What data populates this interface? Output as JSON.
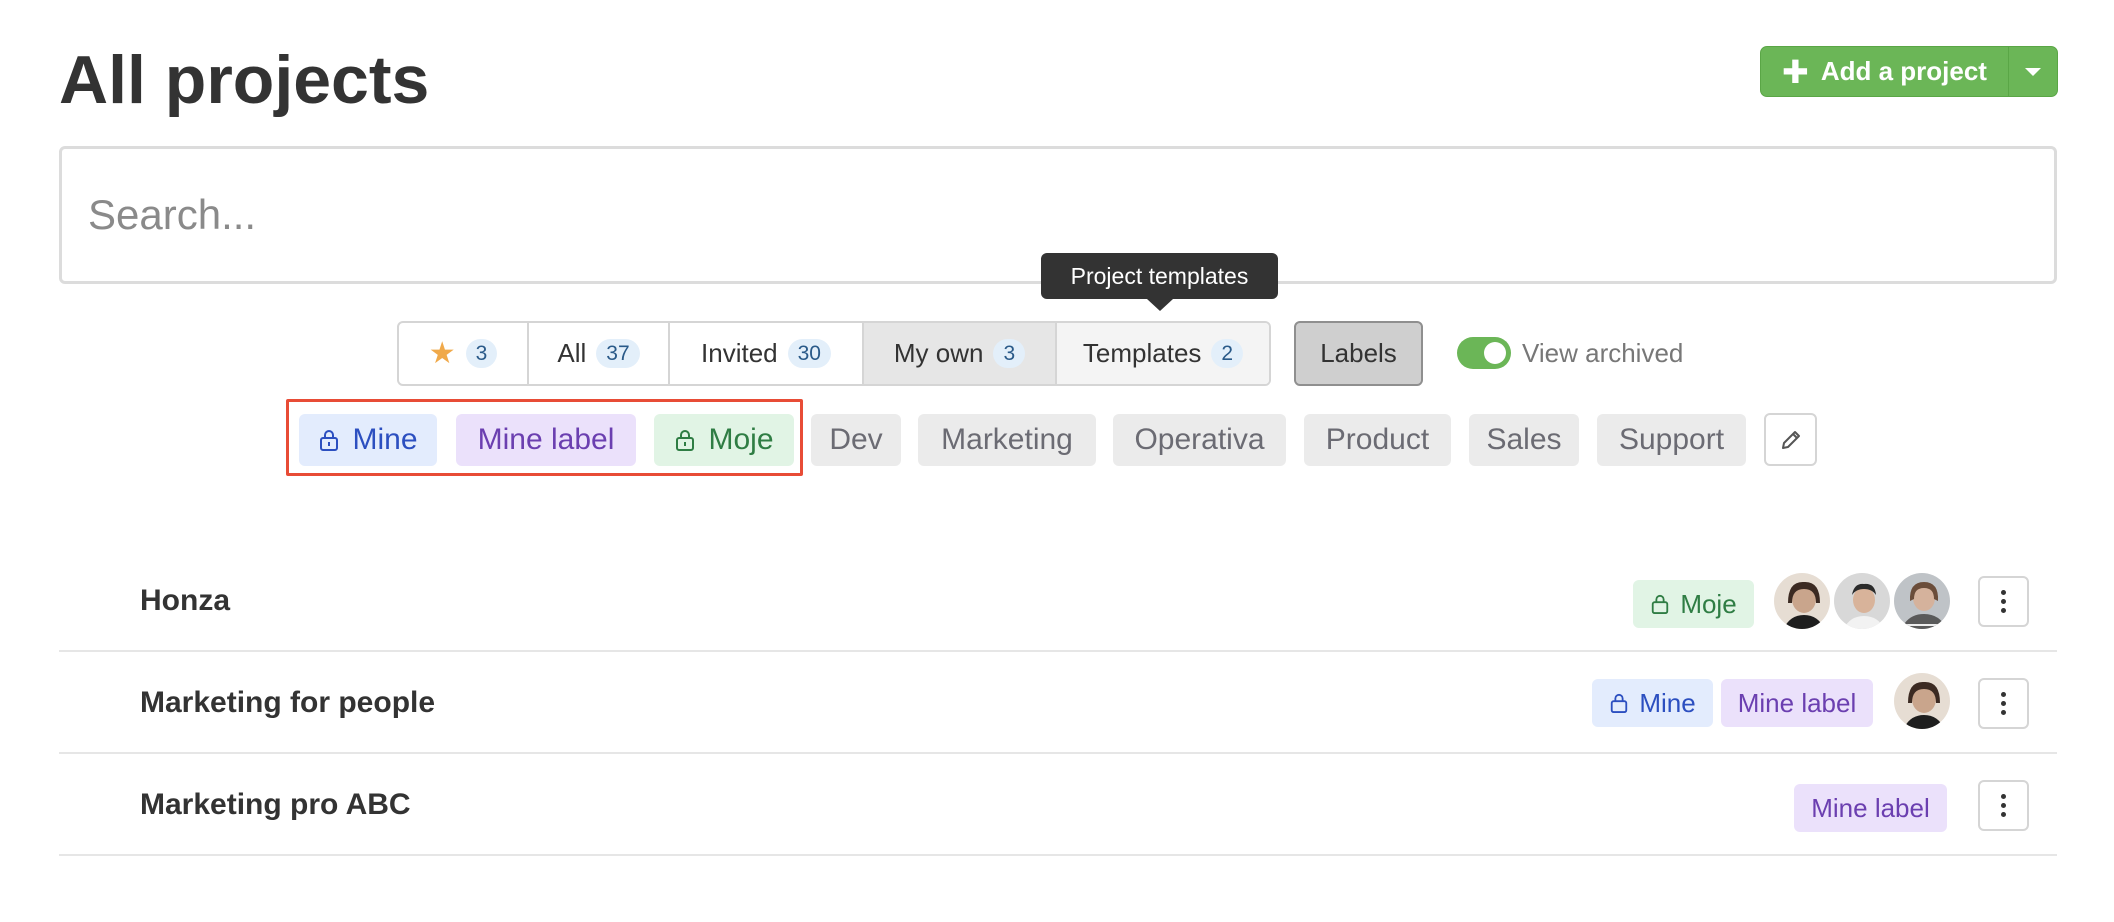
{
  "header": {
    "title": "All projects",
    "add_button_label": "Add a project"
  },
  "search": {
    "placeholder": "Search...",
    "value": ""
  },
  "tooltip": {
    "text": "Project templates"
  },
  "filters": {
    "starred_count": "3",
    "tabs": [
      {
        "label": "All",
        "count": "37"
      },
      {
        "label": "Invited",
        "count": "30"
      },
      {
        "label": "My own",
        "count": "3"
      },
      {
        "label": "Templates",
        "count": "2"
      }
    ],
    "labels_button": "Labels",
    "view_archived_label": "View archived",
    "view_archived_on": true
  },
  "labels": [
    {
      "text": "Mine",
      "locked": true,
      "color": "blue"
    },
    {
      "text": "Mine label",
      "locked": false,
      "color": "purple"
    },
    {
      "text": "Moje",
      "locked": true,
      "color": "green"
    },
    {
      "text": "Dev",
      "locked": false,
      "color": "gray"
    },
    {
      "text": "Marketing",
      "locked": false,
      "color": "gray"
    },
    {
      "text": "Operativa",
      "locked": false,
      "color": "gray"
    },
    {
      "text": "Product",
      "locked": false,
      "color": "gray"
    },
    {
      "text": "Sales",
      "locked": false,
      "color": "gray"
    },
    {
      "text": "Support",
      "locked": false,
      "color": "gray"
    }
  ],
  "projects": [
    {
      "name": "Honza",
      "labels": [
        "Moje"
      ],
      "members": 3
    },
    {
      "name": "Marketing for people",
      "labels": [
        "Mine",
        "Mine label"
      ],
      "members": 1
    },
    {
      "name": "Marketing pro ABC",
      "labels": [
        "Mine label"
      ],
      "members": 0
    }
  ],
  "colors": {
    "accent_green": "#6bb657",
    "highlight_red": "#e84c36",
    "label_blue": "#e3ecfd",
    "label_purple": "#ebe1fb",
    "label_green": "#e1f4e5",
    "label_gray": "#ebebeb"
  }
}
